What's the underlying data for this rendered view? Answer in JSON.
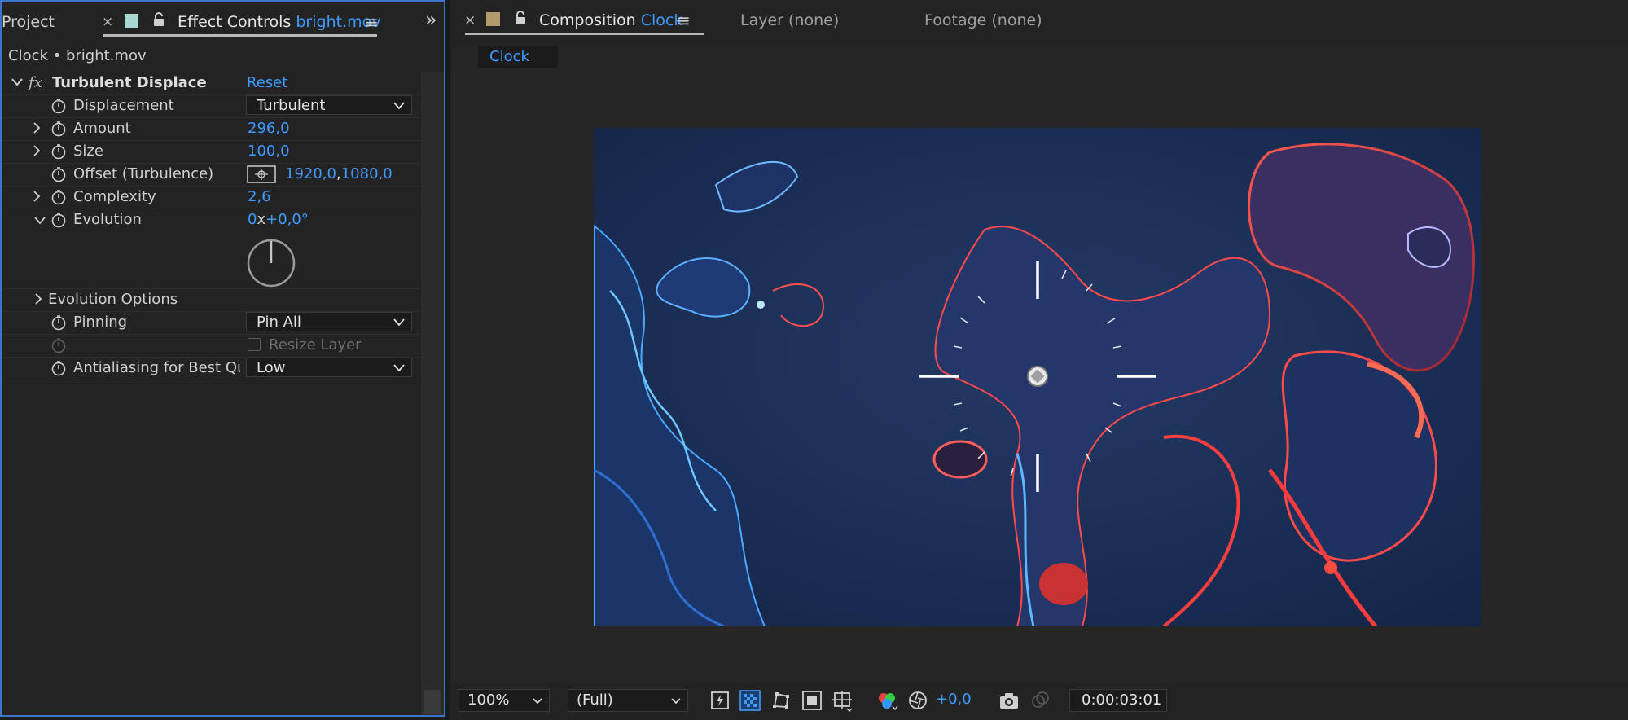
{
  "left_panel": {
    "tabs": {
      "project": "Project",
      "close": "×",
      "effect_controls_prefix": "Effect Controls",
      "effect_controls_layer": "bright.mov",
      "menu": "≡",
      "overflow": "»"
    },
    "subtitle": "Clock • bright.mov",
    "effect": {
      "fx_label": "fx",
      "name": "Turbulent Displace",
      "reset": "Reset"
    },
    "properties": {
      "displacement": {
        "label": "Displacement",
        "value": "Turbulent"
      },
      "amount": {
        "label": "Amount",
        "value": "296,0"
      },
      "size": {
        "label": "Size",
        "value": "100,0"
      },
      "offset": {
        "label": "Offset (Turbulence)",
        "value_x": "1920,0",
        "value_sep": ",",
        "value_y": "1080,0"
      },
      "complexity": {
        "label": "Complexity",
        "value": "2,6"
      },
      "evolution": {
        "label": "Evolution",
        "value_rev": "0",
        "value_x": "x",
        "value_deg": "+0,0°"
      },
      "evolution_options": {
        "label": "Evolution Options"
      },
      "pinning": {
        "label": "Pinning",
        "value": "Pin All"
      },
      "resize_layer": {
        "label": "Resize Layer",
        "checked": false
      },
      "antialiasing": {
        "label": "Antialiasing for Best Qua",
        "value": "Low"
      }
    }
  },
  "right_panel": {
    "tabs": {
      "close": "×",
      "composition_prefix": "Composition",
      "composition_name": "Clock",
      "menu": "≡",
      "layer": "Layer (none)",
      "footage": "Footage (none)"
    },
    "viewer_tab": "Clock",
    "bottom_bar": {
      "zoom": "100%",
      "resolution": "(Full)",
      "exposure": "+0,0",
      "timecode": "0:00:03:01"
    }
  },
  "colors": {
    "accent": "#3d9bff",
    "panel_border": "#3c76c8",
    "label_color_left": "#a8d8d0",
    "label_color_right": "#b39a6a",
    "comp_background": "#1a2c52"
  },
  "icons": [
    "stopwatch-icon",
    "chevron-right-icon",
    "chevron-down-icon",
    "lock-icon",
    "crosshair-icon",
    "camera-icon",
    "color-channels-icon",
    "snapshot-icon"
  ]
}
